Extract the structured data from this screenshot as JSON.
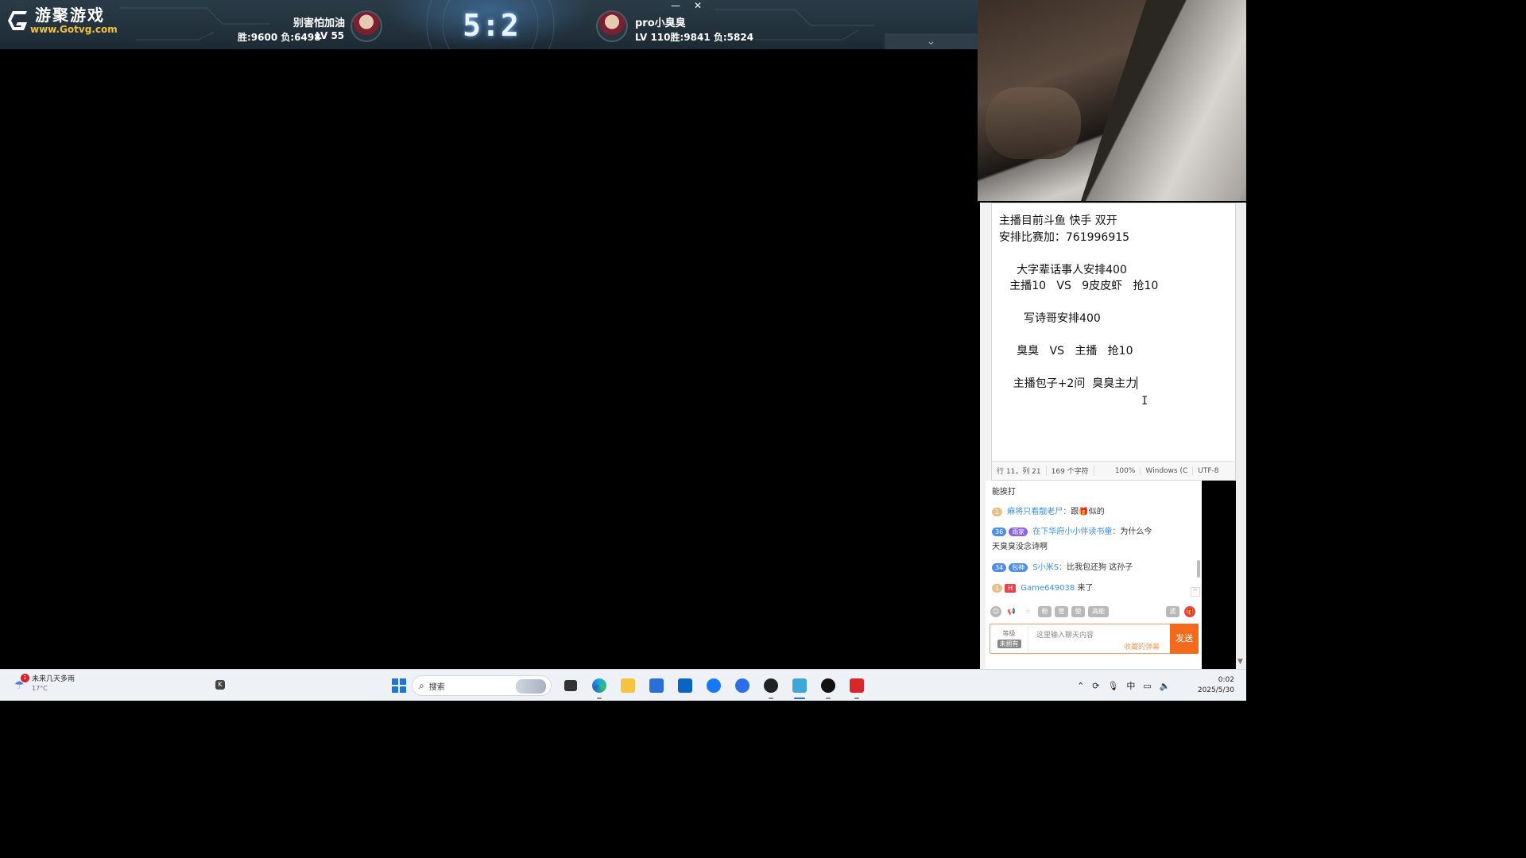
{
  "game": {
    "logo_cn": "游聚游戏",
    "logo_url": "www.Gotvg.com",
    "left_player": {
      "name": "别害怕加油",
      "stats": "胜:9600 负:6498",
      "level": "LV 55"
    },
    "right_player": {
      "name": "pro小臭臭",
      "level_stats": "LV 110胜:9841 负:5824"
    },
    "score": "5:2",
    "window_controls": {
      "minimize": "—",
      "close": "✕"
    },
    "collapse_icon": "chevron-down-icon"
  },
  "notepad": {
    "lines": [
      "  主播目前斗鱼 快手 双开",
      "  安排比赛加：761996915",
      "",
      "       大字辈话事人安排400",
      "     主播10   VS   9皮皮虾   抢10",
      "",
      "         写诗哥安排400",
      "",
      "       臭臭   VS   主播   抢10",
      "",
      "      主播包子+2问  臭臭主力"
    ],
    "status": {
      "position": "行 11，列 21",
      "chars": "169 个字符",
      "zoom": "100%",
      "line_ending": "Windows (C",
      "encoding": "UTF-8"
    }
  },
  "chat": {
    "messages": [
      {
        "text": "能挨打"
      },
      {
        "badge": "1",
        "user": "麻将只看靓老尸：",
        "text": "跟🎁似的"
      },
      {
        "badge": "36",
        "badge2": "雨家",
        "user": "在下华府小小伴读书童：",
        "text": "为什么今",
        "cont": "天臭臭没念诗啊"
      },
      {
        "badge": "34",
        "badge2": "包神",
        "user": "S小米S：",
        "text": "比我包还狗 这孙子"
      },
      {
        "badge": "1",
        "badge2": "H",
        "user": "Game649038",
        "text": " 来了"
      }
    ],
    "tools": [
      "☺",
      "📢",
      "☆",
      "粉",
      "管",
      "使",
      "高能"
    ],
    "input_placeholder": "这里输入聊天内容",
    "level_label": "等级",
    "unowned_label": "未拥有",
    "hint": "收藏的弹幕",
    "send_label": "发送"
  },
  "taskbar": {
    "weather": {
      "badge": "1",
      "text": "未来几天多雨",
      "temp": "17°C"
    },
    "search_label": "搜索",
    "ime": "中",
    "time": "0:02",
    "date": "2025/5/30"
  },
  "colors": {
    "accent": "#f46a1c",
    "chat_user": "#3c8ee6",
    "taskbar_bg": "#eef1f6"
  }
}
